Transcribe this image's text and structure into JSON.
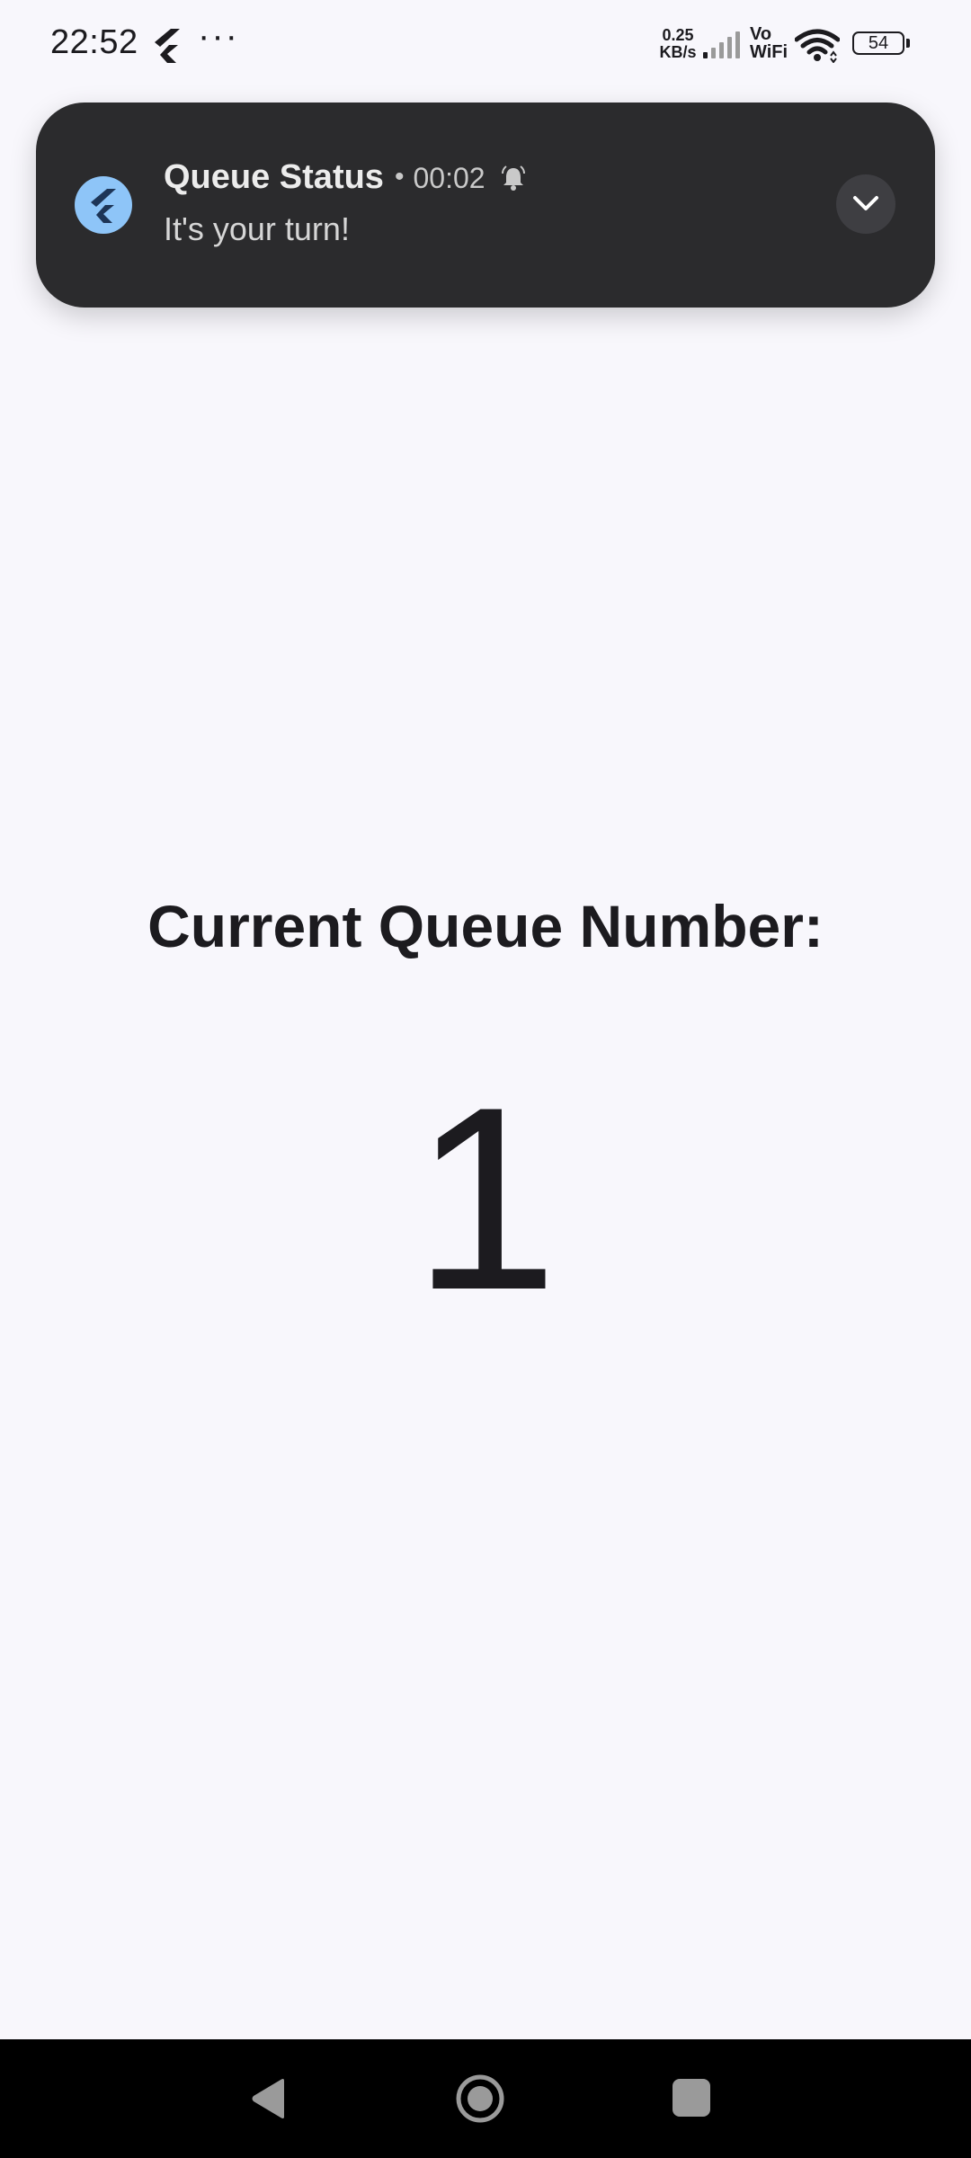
{
  "status_bar": {
    "time": "22:52",
    "more_indicator": "···",
    "net_speed_value": "0.25",
    "net_speed_unit": "KB/s",
    "vowifi_top": "Vo",
    "vowifi_bottom": "WiFi",
    "battery_level": "54",
    "icons": [
      "flutter-app-icon",
      "signal-icon",
      "wifi-icon",
      "battery-icon"
    ]
  },
  "app_bar": {
    "back_icon": "arrow-left-icon"
  },
  "notification": {
    "app_icon": "flutter-logo-icon",
    "title": "Queue Status",
    "separator": "•",
    "time": "00:02",
    "bell_icon": "bell-ringing-icon",
    "body": "It's your turn!",
    "expand_icon": "chevron-down-icon",
    "colors": {
      "background": "#2b2b2d",
      "app_icon_bg": "#8ec5f8"
    }
  },
  "main": {
    "label": "Current Queue Number:",
    "number": "1"
  },
  "nav_bar": {
    "back_icon": "triangle-back-icon",
    "home_icon": "circle-home-icon",
    "recents_icon": "square-recents-icon"
  }
}
